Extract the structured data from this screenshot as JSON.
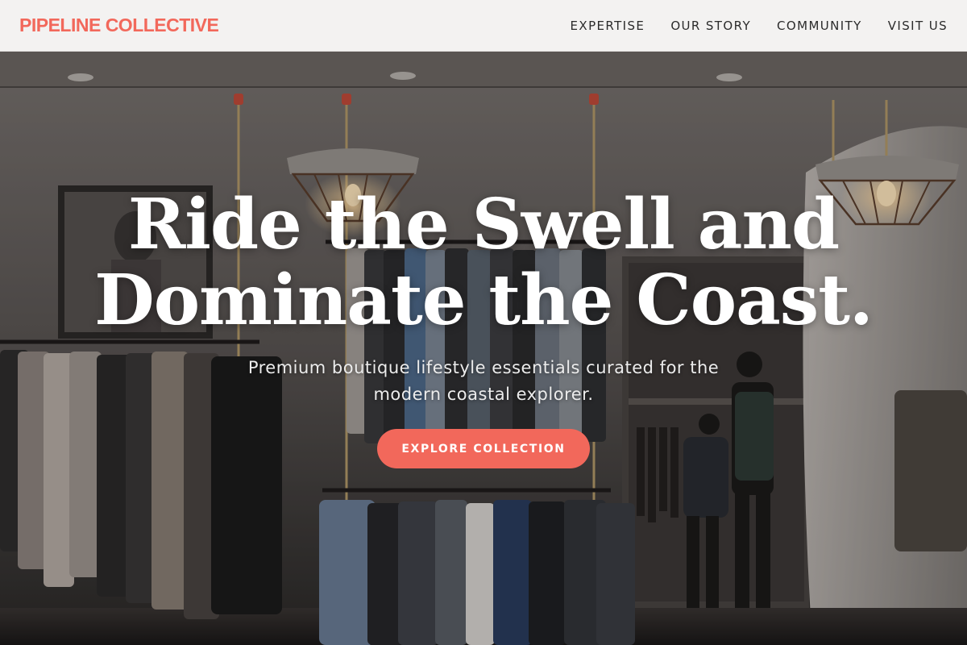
{
  "header": {
    "brand": "PIPELINE COLLECTIVE",
    "nav": [
      {
        "label": "EXPERTISE"
      },
      {
        "label": "OUR STORY"
      },
      {
        "label": "COMMUNITY"
      },
      {
        "label": "VISIT US"
      }
    ]
  },
  "hero": {
    "headline_line1": "Ride the Swell and",
    "headline_line2": "Dominate the Coast.",
    "subhead_line1": "Premium boutique lifestyle essentials curated for the",
    "subhead_line2": "modern coastal explorer.",
    "cta_label": "EXPLORE COLLECTION",
    "background_icon": "boutique-interior-photo"
  },
  "colors": {
    "accent": "#f2685b",
    "header_bg": "#f3f2f1",
    "headline": "#ffffff"
  }
}
